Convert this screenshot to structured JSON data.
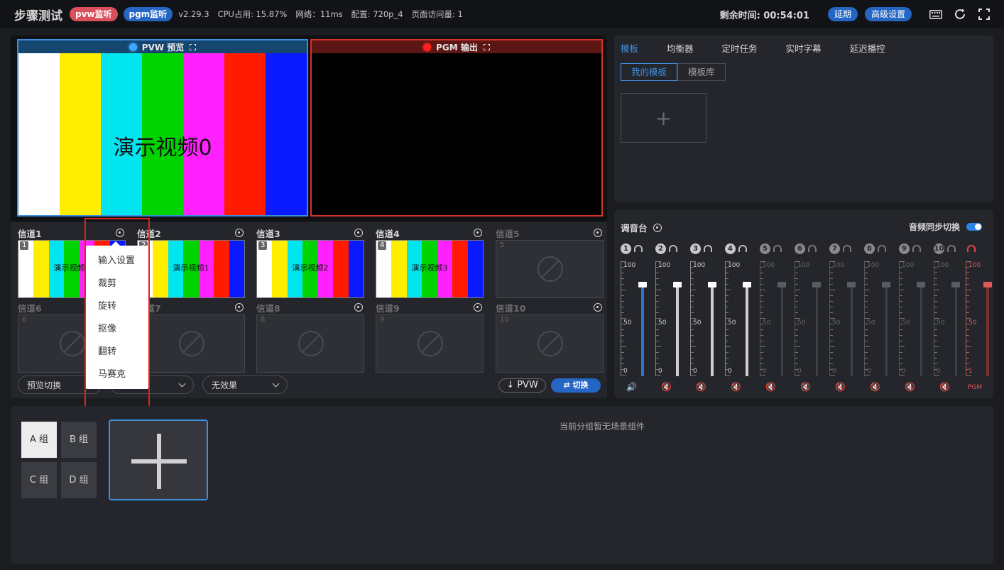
{
  "header": {
    "title": "步骤测试",
    "pvw_listen": "pvw监听",
    "pgm_listen": "pgm监听",
    "version": "v2.29.3",
    "cpu": "CPU占用: 15.87%",
    "network": "网络：11ms",
    "config": "配置: 720p_4",
    "visits": "页面访问量: 1",
    "remaining": "剩余时间: 00:54:01",
    "extend": "延期",
    "advanced": "高级设置"
  },
  "monitors": {
    "pvw_title": "PVW 预览",
    "pgm_title": "PGM 输出",
    "pvw_content": "演示视频0"
  },
  "bar_colors": [
    "#ffffff",
    "#ffee00",
    "#00e5f0",
    "#00d400",
    "#ff22ff",
    "#ff1a00",
    "#0a1aff"
  ],
  "channels": [
    {
      "label": "信道1",
      "num": "1",
      "content": "演示视频0",
      "active": true
    },
    {
      "label": "信道2",
      "num": "2",
      "content": "演示视频1",
      "active": true
    },
    {
      "label": "信道3",
      "num": "3",
      "content": "演示视频2",
      "active": true
    },
    {
      "label": "信道4",
      "num": "4",
      "content": "演示视频3",
      "active": true
    },
    {
      "label": "信道5",
      "num": "5",
      "content": "",
      "active": false
    },
    {
      "label": "信道6",
      "num": "6",
      "content": "",
      "active": false
    },
    {
      "label": "信道7",
      "num": "7",
      "content": "",
      "active": false
    },
    {
      "label": "信道8",
      "num": "8",
      "content": "",
      "active": false
    },
    {
      "label": "信道9",
      "num": "9",
      "content": "",
      "active": false
    },
    {
      "label": "信道10",
      "num": "10",
      "content": "",
      "active": false
    }
  ],
  "controls": {
    "preview_switch": "预览切换",
    "effect": "无效果",
    "pvw_btn": "↓ PVW",
    "switch_btn": "⇄  切换"
  },
  "context_menu": [
    "输入设置",
    "裁剪",
    "旋转",
    "抠像",
    "翻转",
    "马赛克"
  ],
  "templates": {
    "tabs": [
      "模板",
      "均衡器",
      "定时任务",
      "实时字幕",
      "延迟播控"
    ],
    "sub_tabs": [
      "我的模板",
      "模板库"
    ],
    "add": "+"
  },
  "mixer": {
    "title": "调音台",
    "sync_label": "音频同步切换",
    "scale": [
      "100",
      "50",
      "0"
    ],
    "pgm_scale_bottom": "1",
    "pgm_label": "PGM",
    "strips": [
      {
        "num": "1",
        "level": 0.83,
        "state": "active"
      },
      {
        "num": "2",
        "level": 0.83,
        "state": "on"
      },
      {
        "num": "3",
        "level": 0.83,
        "state": "on"
      },
      {
        "num": "4",
        "level": 0.83,
        "state": "on"
      },
      {
        "num": "5",
        "level": 0.83,
        "state": "off"
      },
      {
        "num": "6",
        "level": 0.83,
        "state": "off"
      },
      {
        "num": "7",
        "level": 0.83,
        "state": "off"
      },
      {
        "num": "8",
        "level": 0.83,
        "state": "off"
      },
      {
        "num": "9",
        "level": 0.83,
        "state": "off"
      },
      {
        "num": "10",
        "level": 0.83,
        "state": "off"
      }
    ]
  },
  "scenes": {
    "groups": [
      "A 组",
      "B 组",
      "C 组",
      "D 组"
    ],
    "empty_message": "当前分组暂无场景组件"
  }
}
